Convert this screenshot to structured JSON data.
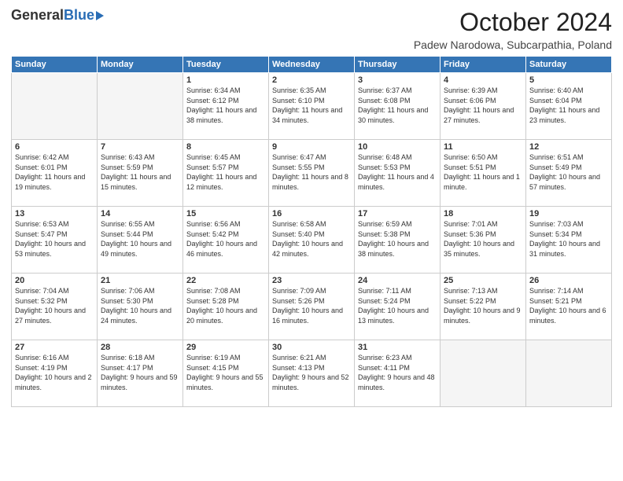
{
  "logo": {
    "general": "General",
    "blue": "Blue"
  },
  "title": "October 2024",
  "location": "Padew Narodowa, Subcarpathia, Poland",
  "days_header": [
    "Sunday",
    "Monday",
    "Tuesday",
    "Wednesday",
    "Thursday",
    "Friday",
    "Saturday"
  ],
  "weeks": [
    [
      {
        "day": "",
        "info": ""
      },
      {
        "day": "",
        "info": ""
      },
      {
        "day": "1",
        "info": "Sunrise: 6:34 AM\nSunset: 6:12 PM\nDaylight: 11 hours and 38 minutes."
      },
      {
        "day": "2",
        "info": "Sunrise: 6:35 AM\nSunset: 6:10 PM\nDaylight: 11 hours and 34 minutes."
      },
      {
        "day": "3",
        "info": "Sunrise: 6:37 AM\nSunset: 6:08 PM\nDaylight: 11 hours and 30 minutes."
      },
      {
        "day": "4",
        "info": "Sunrise: 6:39 AM\nSunset: 6:06 PM\nDaylight: 11 hours and 27 minutes."
      },
      {
        "day": "5",
        "info": "Sunrise: 6:40 AM\nSunset: 6:04 PM\nDaylight: 11 hours and 23 minutes."
      }
    ],
    [
      {
        "day": "6",
        "info": "Sunrise: 6:42 AM\nSunset: 6:01 PM\nDaylight: 11 hours and 19 minutes."
      },
      {
        "day": "7",
        "info": "Sunrise: 6:43 AM\nSunset: 5:59 PM\nDaylight: 11 hours and 15 minutes."
      },
      {
        "day": "8",
        "info": "Sunrise: 6:45 AM\nSunset: 5:57 PM\nDaylight: 11 hours and 12 minutes."
      },
      {
        "day": "9",
        "info": "Sunrise: 6:47 AM\nSunset: 5:55 PM\nDaylight: 11 hours and 8 minutes."
      },
      {
        "day": "10",
        "info": "Sunrise: 6:48 AM\nSunset: 5:53 PM\nDaylight: 11 hours and 4 minutes."
      },
      {
        "day": "11",
        "info": "Sunrise: 6:50 AM\nSunset: 5:51 PM\nDaylight: 11 hours and 1 minute."
      },
      {
        "day": "12",
        "info": "Sunrise: 6:51 AM\nSunset: 5:49 PM\nDaylight: 10 hours and 57 minutes."
      }
    ],
    [
      {
        "day": "13",
        "info": "Sunrise: 6:53 AM\nSunset: 5:47 PM\nDaylight: 10 hours and 53 minutes."
      },
      {
        "day": "14",
        "info": "Sunrise: 6:55 AM\nSunset: 5:44 PM\nDaylight: 10 hours and 49 minutes."
      },
      {
        "day": "15",
        "info": "Sunrise: 6:56 AM\nSunset: 5:42 PM\nDaylight: 10 hours and 46 minutes."
      },
      {
        "day": "16",
        "info": "Sunrise: 6:58 AM\nSunset: 5:40 PM\nDaylight: 10 hours and 42 minutes."
      },
      {
        "day": "17",
        "info": "Sunrise: 6:59 AM\nSunset: 5:38 PM\nDaylight: 10 hours and 38 minutes."
      },
      {
        "day": "18",
        "info": "Sunrise: 7:01 AM\nSunset: 5:36 PM\nDaylight: 10 hours and 35 minutes."
      },
      {
        "day": "19",
        "info": "Sunrise: 7:03 AM\nSunset: 5:34 PM\nDaylight: 10 hours and 31 minutes."
      }
    ],
    [
      {
        "day": "20",
        "info": "Sunrise: 7:04 AM\nSunset: 5:32 PM\nDaylight: 10 hours and 27 minutes."
      },
      {
        "day": "21",
        "info": "Sunrise: 7:06 AM\nSunset: 5:30 PM\nDaylight: 10 hours and 24 minutes."
      },
      {
        "day": "22",
        "info": "Sunrise: 7:08 AM\nSunset: 5:28 PM\nDaylight: 10 hours and 20 minutes."
      },
      {
        "day": "23",
        "info": "Sunrise: 7:09 AM\nSunset: 5:26 PM\nDaylight: 10 hours and 16 minutes."
      },
      {
        "day": "24",
        "info": "Sunrise: 7:11 AM\nSunset: 5:24 PM\nDaylight: 10 hours and 13 minutes."
      },
      {
        "day": "25",
        "info": "Sunrise: 7:13 AM\nSunset: 5:22 PM\nDaylight: 10 hours and 9 minutes."
      },
      {
        "day": "26",
        "info": "Sunrise: 7:14 AM\nSunset: 5:21 PM\nDaylight: 10 hours and 6 minutes."
      }
    ],
    [
      {
        "day": "27",
        "info": "Sunrise: 6:16 AM\nSunset: 4:19 PM\nDaylight: 10 hours and 2 minutes."
      },
      {
        "day": "28",
        "info": "Sunrise: 6:18 AM\nSunset: 4:17 PM\nDaylight: 9 hours and 59 minutes."
      },
      {
        "day": "29",
        "info": "Sunrise: 6:19 AM\nSunset: 4:15 PM\nDaylight: 9 hours and 55 minutes."
      },
      {
        "day": "30",
        "info": "Sunrise: 6:21 AM\nSunset: 4:13 PM\nDaylight: 9 hours and 52 minutes."
      },
      {
        "day": "31",
        "info": "Sunrise: 6:23 AM\nSunset: 4:11 PM\nDaylight: 9 hours and 48 minutes."
      },
      {
        "day": "",
        "info": ""
      },
      {
        "day": "",
        "info": ""
      }
    ]
  ]
}
